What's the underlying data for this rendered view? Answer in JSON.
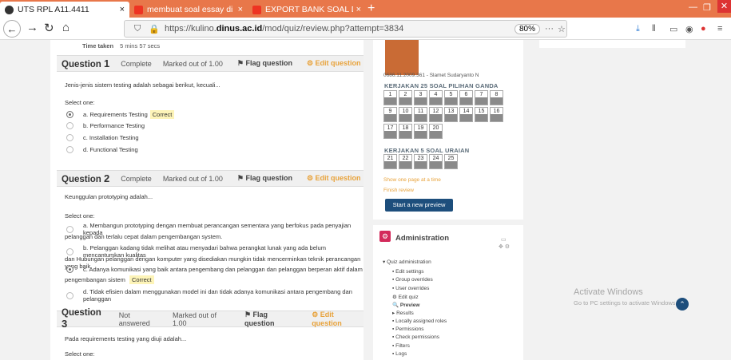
{
  "browser": {
    "tabs": [
      {
        "label": "UTS RPL A11.4411",
        "close": "×"
      },
      {
        "label": "membuat soal essay di moodle",
        "close": "×"
      },
      {
        "label": "EXPORT BANK SOAL DAN SETI",
        "close": "×"
      }
    ],
    "new_tab": "+",
    "url_prefix": "https://kulino.",
    "url_host": "dinus.ac.id",
    "url_path": "/mod/quiz/review.php?attempt=3834",
    "zoom": "80%",
    "dots": "···"
  },
  "time_taken": {
    "label": "Time taken",
    "value": "5 mins 57 secs"
  },
  "questions": [
    {
      "prefix": "Question",
      "number": "1",
      "status": "Complete",
      "marks": "Marked out of 1.00",
      "flag": "Flag question",
      "edit": "Edit question",
      "text": "Jenis-jenis sistem testing adalah sebagai berikut, kecuali...",
      "select": "Select one:",
      "options": [
        {
          "text": "a. Requirements Testing",
          "badge": "Correct"
        },
        {
          "text": "b. Performance Testing"
        },
        {
          "text": "c. Installation Testing"
        },
        {
          "text": "d. Functional Testing"
        }
      ]
    },
    {
      "prefix": "Question",
      "number": "2",
      "status": "Complete",
      "marks": "Marked out of 1.00",
      "flag": "Flag question",
      "edit": "Edit question",
      "text": "Keunggulan prototyping adalah...",
      "select": "Select one:",
      "options": [
        {
          "line1": "a. Membangun prototyping dengan membuat perancangan sementara yang berfokus pada penyajian kepada",
          "line2": "pelanggan dan terlalu cepat dalam pengembangan system."
        },
        {
          "line1": "b. Pelanggan kadang tidak melihat atau menyadari bahwa perangkat lunak yang ada belum mencantumkan kualitas",
          "line2": "dan Hubungan pelanggan dengan komputer yang disediakan mungkin tidak mencerminkan teknik perancangan yang baik"
        },
        {
          "line1": "c. Adanya komunikasi yang baik antara pengembang dan pelanggan dan pelanggan berperan aktif dalam",
          "line2": "pengembangan sistem",
          "badge": "Correct"
        },
        {
          "line1": "d. Tidak efisien dalam menggunakan model ini dan tidak adanya komunikasi antara pengembang dan pelanggan"
        }
      ]
    },
    {
      "prefix": "Question",
      "number": "3",
      "status": "Not answered",
      "marks": "Marked out of 1.00",
      "flag": "Flag question",
      "edit": "Edit question",
      "text": "Pada requirements testing yang diuji adalah...",
      "select": "Select one:"
    }
  ],
  "sidebar": {
    "user": "0686.11.2009.361 - Slamet Sudaryanto N",
    "section1": "KERJAKAN 25 SOAL PILIHAN GANDA",
    "buttons1": [
      "1",
      "2",
      "3",
      "4",
      "5",
      "6",
      "7",
      "8",
      "9",
      "10",
      "11",
      "12",
      "13",
      "14",
      "15",
      "16",
      "17",
      "18",
      "19",
      "20"
    ],
    "section2": "KERJAKAN 5 SOAL URAIAN",
    "buttons2": [
      "21",
      "22",
      "23",
      "24",
      "25"
    ],
    "show_one": "Show one page at a time",
    "finish": "Finish review",
    "start": "Start a new preview"
  },
  "admin": {
    "title": "Administration",
    "items": [
      "Quiz administration",
      "Edit settings",
      "Group overrides",
      "User overrides",
      "Edit quiz",
      "Preview",
      "Results",
      "Locally assigned roles",
      "Permissions",
      "Check permissions",
      "Filters",
      "Logs"
    ]
  },
  "watermark": {
    "title": "Activate Windows",
    "sub": "Go to PC settings to activate Windows."
  },
  "colors": {
    "tabbar": "#e8774a",
    "accent": "#e8a23a",
    "primary": "#1d4e7c",
    "badge": "#fdf4b8"
  }
}
